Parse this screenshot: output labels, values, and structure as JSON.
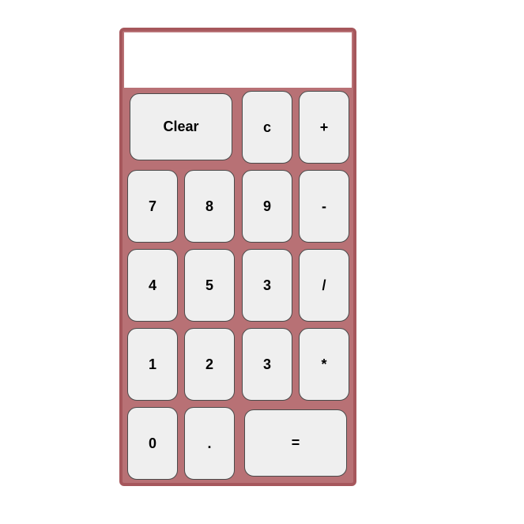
{
  "display": {
    "value": ""
  },
  "buttons": {
    "clear": "Clear",
    "c": "c",
    "plus": "+",
    "seven": "7",
    "eight": "8",
    "nine": "9",
    "minus": "-",
    "four": "4",
    "five": "5",
    "three_a": "3",
    "divide": "/",
    "one": "1",
    "two": "2",
    "three_b": "3",
    "multiply": "*",
    "zero": "0",
    "dot": ".",
    "equals": "="
  },
  "colors": {
    "body": "#b87175",
    "border": "#a6575c",
    "button": "#efefef",
    "display": "#ffffff"
  }
}
